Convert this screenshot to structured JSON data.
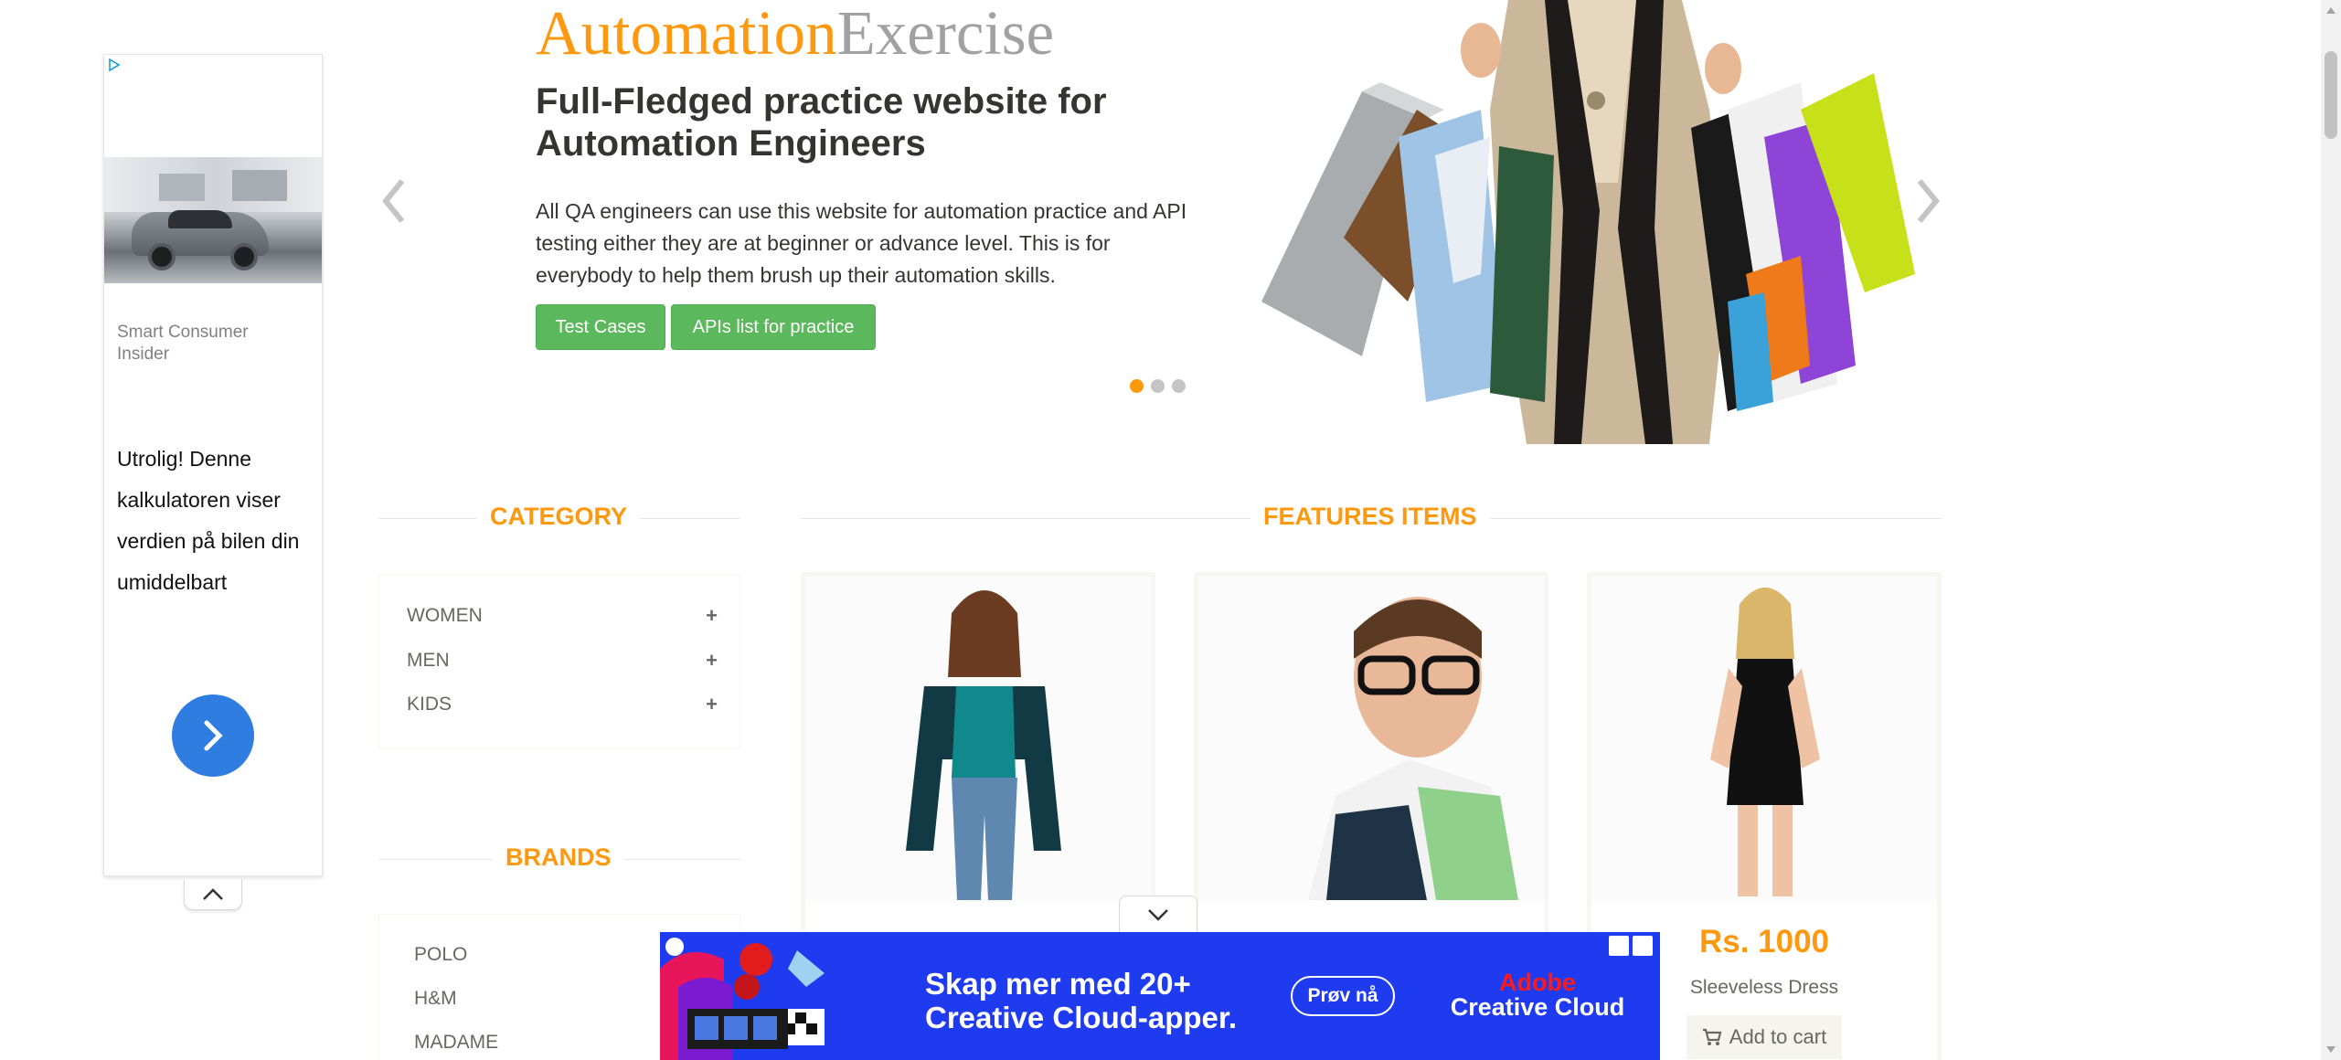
{
  "logo": {
    "part1": "Automation",
    "part2": "Exercise"
  },
  "hero": {
    "title": "Full-Fledged practice website for Automation Engineers",
    "description": "All QA engineers can use this website for automation practice and API testing either they are at beginner or advance level. This is for everybody to help them brush up their automation skills.",
    "buttons": {
      "test_cases": "Test Cases",
      "apis": "APIs list for practice"
    },
    "slides": {
      "count": 3,
      "active": 1
    }
  },
  "side_ad": {
    "source": "Smart Consumer Insider",
    "headline": "Utrolig! Denne kalkulatoren viser verdien på bilen din umiddelbart"
  },
  "category": {
    "title": "CATEGORY",
    "items": [
      "WOMEN",
      "MEN",
      "KIDS"
    ]
  },
  "brands": {
    "title": "BRANDS",
    "items": [
      "POLO",
      "H&M",
      "MADAME"
    ]
  },
  "features": {
    "title": "FEATURES ITEMS",
    "products": [
      {
        "price": "",
        "name": ""
      },
      {
        "price": "",
        "name": ""
      },
      {
        "price": "Rs. 1000",
        "name": "Sleeveless Dress",
        "cart": "Add to cart"
      }
    ]
  },
  "bottom_ad": {
    "headline": "Skap mer med 20+ Creative Cloud-apper.",
    "button": "Prøv nå",
    "brand_line1": "Adobe",
    "brand_line2": "Creative Cloud"
  },
  "colors": {
    "accent": "#fe980f",
    "green": "#5cb85c",
    "ad_blue": "#1f3bf0"
  }
}
